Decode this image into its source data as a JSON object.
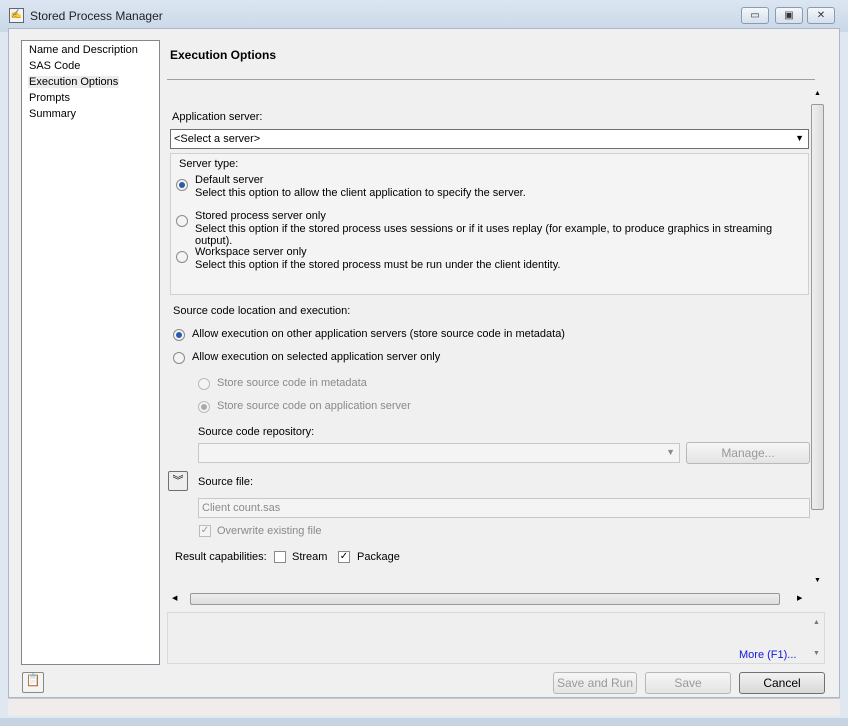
{
  "window": {
    "title": "Stored Process Manager",
    "minimize": "▭",
    "maximize": "▣",
    "close": "✕"
  },
  "nav": {
    "items": [
      "Name and Description",
      "SAS Code",
      "Execution Options",
      "Prompts",
      "Summary"
    ]
  },
  "heading": "Execution Options",
  "app_server": {
    "label": "Application server:",
    "value": "<Select a server>"
  },
  "server_type": {
    "label": "Server type:",
    "options": [
      {
        "title": "Default server",
        "desc": "Select this option to allow the client application to specify the server."
      },
      {
        "title": "Stored process server only",
        "desc": "Select this option if the stored process uses sessions or if it uses replay (for example, to produce graphics in streaming output)."
      },
      {
        "title": "Workspace server only",
        "desc": "Select this option if the stored process must be run under the client identity."
      }
    ]
  },
  "source": {
    "label": "Source code location and execution:",
    "opt1": "Allow execution on other application servers (store source code in metadata)",
    "opt2": "Allow execution on selected application server only",
    "sub1": "Store source code in metadata",
    "sub2": "Store source code on application server",
    "repo_label": "Source code repository:",
    "repo_value": "",
    "manage": "Manage...",
    "file_label": "Source file:",
    "file_value": "Client count.sas",
    "overwrite": "Overwrite existing file"
  },
  "result": {
    "label": "Result capabilities:",
    "stream": "Stream",
    "package": "Package"
  },
  "help": {
    "more": "More (F1)..."
  },
  "buttons": {
    "save_run": "Save and Run",
    "save": "Save",
    "cancel": "Cancel"
  }
}
